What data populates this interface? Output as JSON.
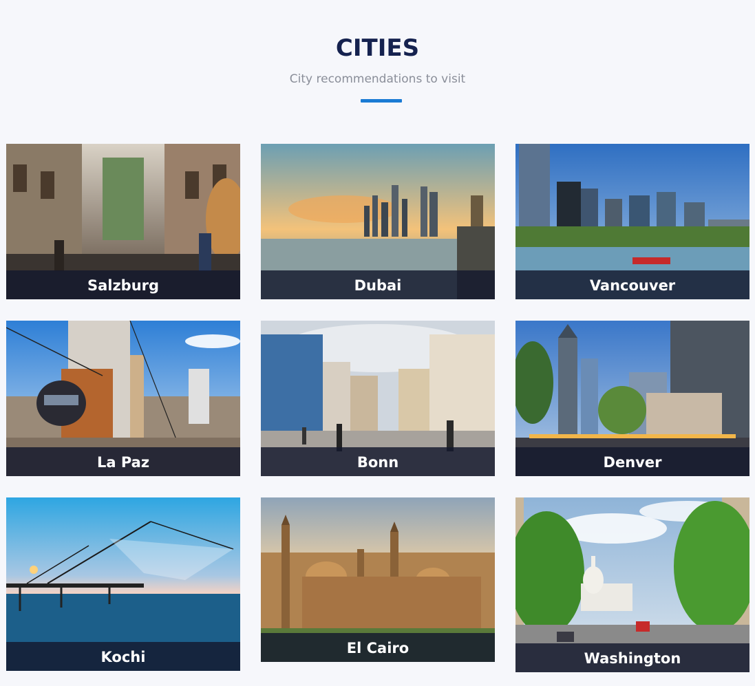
{
  "header": {
    "title": "CITIES",
    "subtitle": "City recommendations to visit"
  },
  "colors": {
    "accent": "#1a7bd4",
    "title": "#15224f",
    "background": "#f6f7fb",
    "caption_overlay": "#14182d"
  },
  "cities": [
    {
      "name": "Salzburg",
      "image": "salzburg-street-photo"
    },
    {
      "name": "Dubai",
      "image": "dubai-skyline-photo"
    },
    {
      "name": "Vancouver",
      "image": "vancouver-skyline-photo"
    },
    {
      "name": "La Paz",
      "image": "la-paz-cable-car-photo"
    },
    {
      "name": "Bonn",
      "image": "bonn-square-photo"
    },
    {
      "name": "Denver",
      "image": "denver-downtown-photo"
    },
    {
      "name": "Kochi",
      "image": "kochi-fishing-nets-photo"
    },
    {
      "name": "El Cairo",
      "image": "cairo-mosques-photo"
    },
    {
      "name": "Washington",
      "image": "washington-capitol-photo"
    }
  ]
}
